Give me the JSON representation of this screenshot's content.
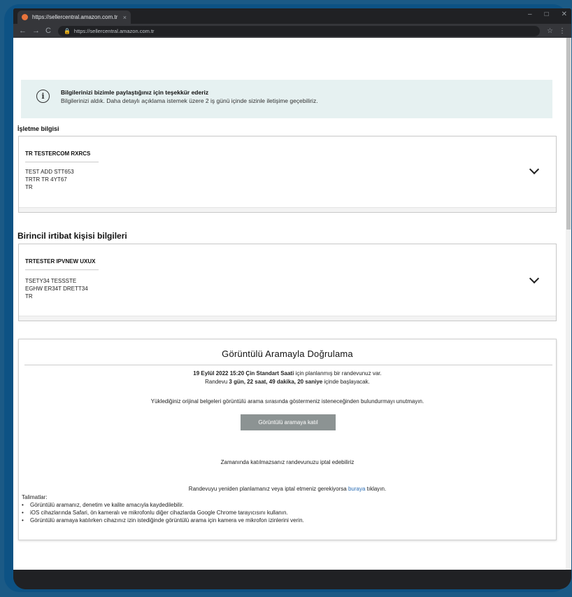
{
  "browser": {
    "tab_title": "https://sellercentral.amazon.com.tr",
    "tab_close": "×",
    "url": "https://sellercentral.amazon.com.tr",
    "nav_back": "←",
    "nav_forward": "→",
    "nav_reload": "C",
    "window_min": "‒",
    "window_max": "□",
    "window_close": "✕",
    "star": "☆",
    "menu": "⋮"
  },
  "info_banner": {
    "icon": "i",
    "title": "Bilgilerinizi bizimle paylaştığınız için teşekkür ederiz",
    "body": "Bilgilerinizi aldık. Daha detaylı açıklama istemek üzere 2 iş günü içinde sizinle iletişime geçebiliriz."
  },
  "business": {
    "heading": "İşletme bilgisi",
    "name": "TR TESTERCOM RXRCS",
    "lines": [
      "TEST ADD STT653",
      "TRTR TR 4YT67",
      "TR"
    ]
  },
  "contact": {
    "heading": "Birincil irtibat kişisi bilgileri",
    "name": "TRTESTER IPVNEW UXUX",
    "lines": [
      "TSETY34 TESSSTE",
      "EGHW ER34T DRETT34",
      "TR"
    ]
  },
  "video": {
    "title": "Görüntülü Aramayla Doğrulama",
    "schedule_date": "19 Eylül 2022 15:20 Çin Standart Saati",
    "schedule_suffix": " için planlanmış bir randevunuz var.",
    "countdown_prefix": "Randevu ",
    "countdown": "3 gün, 22 saat, 49 dakika, 20 saniye",
    "countdown_suffix": " içinde başlayacak.",
    "reminder": "Yüklediğiniz orijinal belgeleri görüntülü arama sırasında göstermeniz isteneceğinden bulundurmayı unutmayın.",
    "join_button": "Görüntülü aramaya katıl",
    "cancel_notice": "Zamanında katılmazsanız randevunuzu iptal edebiliriz",
    "reschedule_prefix": "Randevuyu yeniden planlamanız veya iptal etmeniz gerekiyorsa ",
    "reschedule_link": "buraya",
    "reschedule_suffix": " tıklayın.",
    "instructions_label": "Talimatlar:",
    "instructions": [
      "Görüntülü aramanız, denetim ve kalite amacıyla kaydedilebilir.",
      "iOS cihazlarında Safari, ön kameralı ve mikrofonlu diğer cihazlarda Google Chrome tarayıcısını kullanın.",
      "Görüntülü aramaya katılırken cihazınız izin istediğinde görüntülü arama için kamera ve mikrofon izinlerini verin."
    ]
  }
}
